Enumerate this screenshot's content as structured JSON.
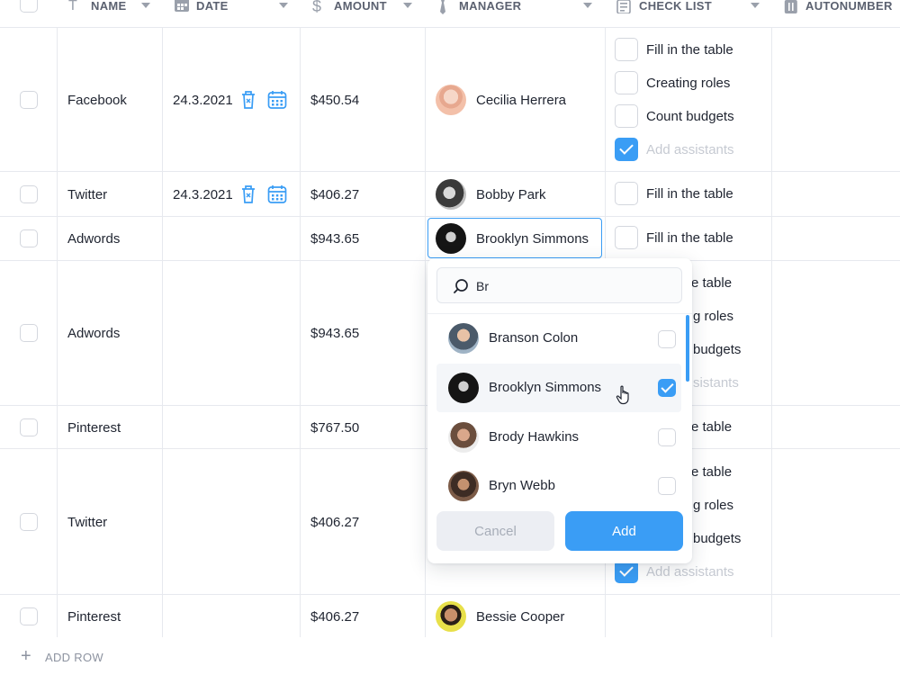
{
  "columns": {
    "name": "NAME",
    "date": "DATE",
    "amount": "AMOUNT",
    "manager": "MANAGER",
    "checklist": "CHECK LIST",
    "autonumber": "AUTONUMBER"
  },
  "rows": [
    {
      "name": "Facebook",
      "date": "24.3.2021",
      "amount": "$450.54",
      "manager": "Cecilia Herrera",
      "checklist": [
        {
          "label": "Fill in the table",
          "checked": false
        },
        {
          "label": "Creating roles",
          "checked": false
        },
        {
          "label": "Count budgets",
          "checked": false
        },
        {
          "label": "Add assistants",
          "checked": true
        }
      ]
    },
    {
      "name": "Twitter",
      "date": "24.3.2021",
      "amount": "$406.27",
      "manager": "Bobby Park",
      "checklist": [
        {
          "label": "Fill in the table",
          "checked": false
        }
      ]
    },
    {
      "name": "Adwords",
      "date": "",
      "amount": "$943.65",
      "manager": "Brooklyn Simmons",
      "checklist": [
        {
          "label": "Fill in the table",
          "checked": false
        }
      ]
    },
    {
      "name": "Adwords",
      "date": "",
      "amount": "$943.65",
      "manager": "",
      "checklist_visible": [
        "e table",
        "g roles",
        "budgets",
        "sistants"
      ]
    },
    {
      "name": "Pinterest",
      "date": "",
      "amount": "$767.50",
      "manager": "",
      "checklist_visible": [
        "e table"
      ]
    },
    {
      "name": "Twitter",
      "date": "",
      "amount": "$406.27",
      "manager": "",
      "checklist_visible": [
        "e table",
        "g roles",
        "budgets"
      ],
      "checklist_last": {
        "label": "Add assistants",
        "checked": true
      }
    },
    {
      "name": "Pinterest",
      "date": "",
      "amount": "$406.27",
      "manager": "Bessie Cooper"
    }
  ],
  "popup": {
    "search_value": "Br",
    "options": [
      {
        "name": "Branson Colon",
        "checked": false
      },
      {
        "name": "Brooklyn Simmons",
        "checked": true
      },
      {
        "name": "Brody Hawkins",
        "checked": false
      },
      {
        "name": "Bryn Webb",
        "checked": false
      }
    ],
    "cancel_label": "Cancel",
    "add_label": "Add"
  },
  "footer": {
    "add_row_label": "ADD ROW"
  },
  "icons": {
    "header_name": "text-icon",
    "header_date": "calendar-icon",
    "header_amount": "dollar-icon",
    "header_manager": "tie-icon",
    "header_checklist": "list-icon",
    "header_autonumber": "number-icon",
    "row_delete": "trash-icon",
    "row_calendar": "calendar-icon",
    "search": "search-icon",
    "add_row": "plus-icon"
  },
  "colors": {
    "accent": "#3a9df5",
    "border": "#e7e9ee"
  }
}
